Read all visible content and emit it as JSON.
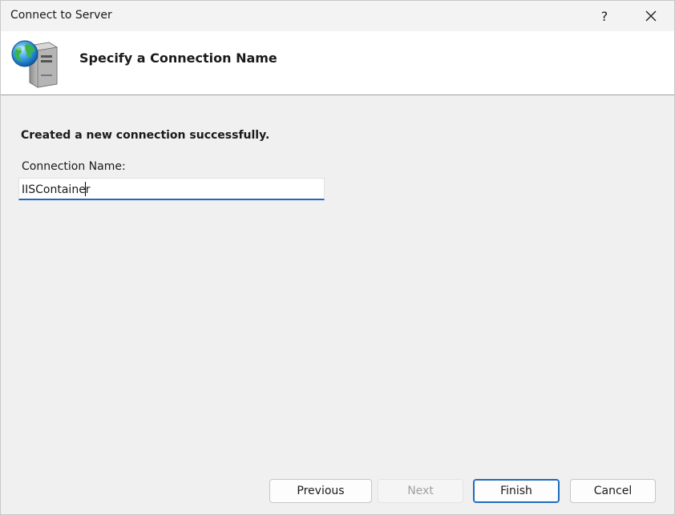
{
  "window": {
    "title": "Connect to Server",
    "help_label": "?",
    "close_icon": "close-icon"
  },
  "header": {
    "title": "Specify a Connection Name",
    "icon": "server-globe-icon"
  },
  "content": {
    "success_message": "Created a new connection successfully.",
    "connection_name_label": "Connection Name:",
    "connection_name_value": "IISContainer"
  },
  "buttons": {
    "previous": "Previous",
    "next": "Next",
    "finish": "Finish",
    "cancel": "Cancel"
  },
  "colors": {
    "accent": "#1d6bbf",
    "disabled_text": "#a0a0a0"
  }
}
